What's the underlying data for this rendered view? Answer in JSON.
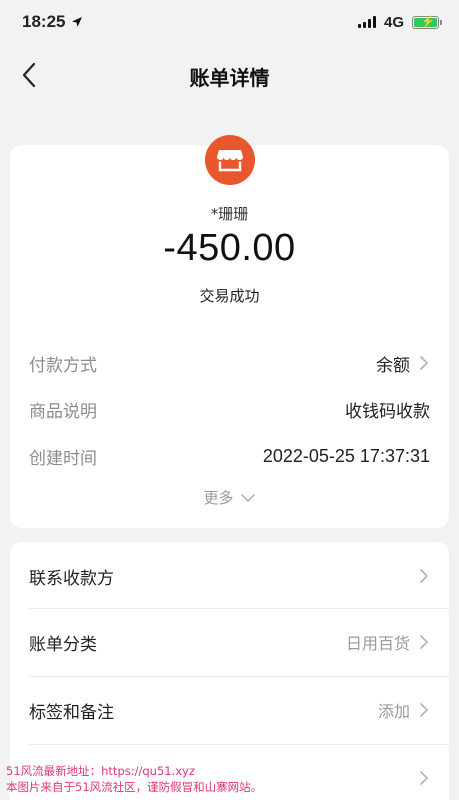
{
  "status_bar": {
    "time": "18:25",
    "network": "4G"
  },
  "nav": {
    "title": "账单详情"
  },
  "transaction": {
    "merchant": "*珊珊",
    "amount": "-450.00",
    "status": "交易成功"
  },
  "details": [
    {
      "label": "付款方式",
      "value": "余额"
    },
    {
      "label": "商品说明",
      "value": "收钱码收款"
    },
    {
      "label": "创建时间",
      "value": "2022-05-25 17:37:31"
    }
  ],
  "more_label": "更多",
  "actions": [
    {
      "label": "联系收款方",
      "value": ""
    },
    {
      "label": "账单分类",
      "value": "日用百货"
    },
    {
      "label": "标签和备注",
      "value": "添加"
    },
    {
      "label": "",
      "value": ""
    }
  ],
  "watermark": {
    "line1": "51风流最新地址：https://qu51.xyz",
    "line2": "本图片来自于51风流社区，谨防假冒和山寨网站。"
  },
  "colors": {
    "brand": "#e9572c",
    "watermark": "#e0357a",
    "battery": "#34c759"
  }
}
